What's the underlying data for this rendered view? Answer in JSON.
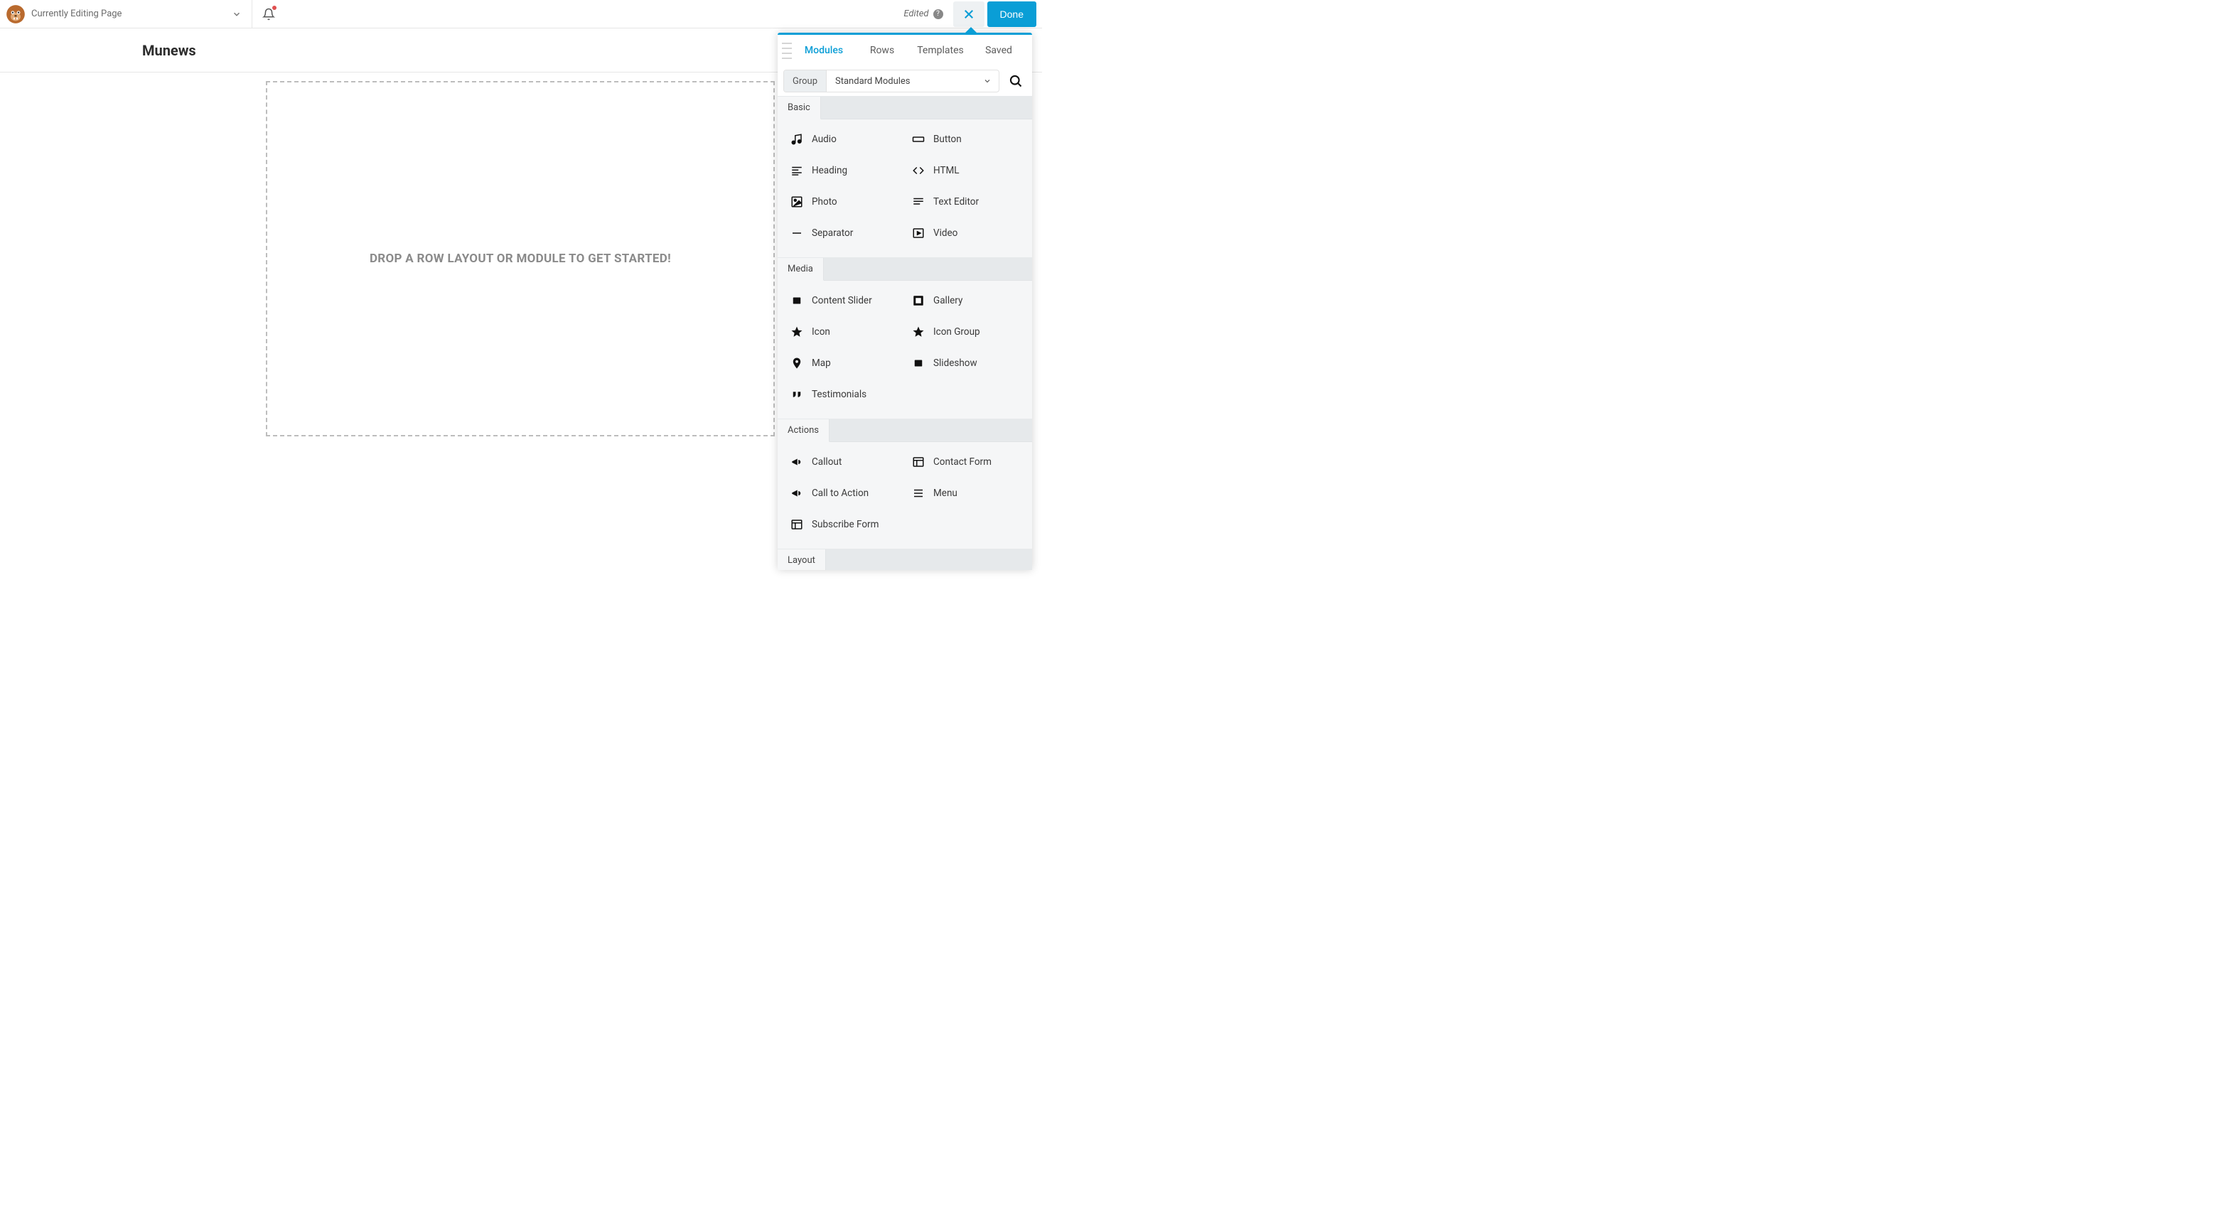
{
  "header": {
    "editing_label": "Currently Editing Page",
    "edited_label": "Edited",
    "done_label": "Done"
  },
  "page": {
    "title": "Munews",
    "dropzone_text": "DROP A ROW LAYOUT OR MODULE TO GET STARTED!"
  },
  "panel": {
    "tabs": {
      "modules": "Modules",
      "rows": "Rows",
      "templates": "Templates",
      "saved": "Saved"
    },
    "active_tab": "modules",
    "group_label": "Group",
    "group_value": "Standard Modules",
    "sections": [
      {
        "title": "Basic",
        "items": [
          {
            "name": "audio",
            "label": "Audio",
            "icon": "music"
          },
          {
            "name": "button",
            "label": "Button",
            "icon": "rect"
          },
          {
            "name": "heading",
            "label": "Heading",
            "icon": "lines-heading"
          },
          {
            "name": "html",
            "label": "HTML",
            "icon": "code"
          },
          {
            "name": "photo",
            "label": "Photo",
            "icon": "image"
          },
          {
            "name": "text-editor",
            "label": "Text Editor",
            "icon": "lines"
          },
          {
            "name": "separator",
            "label": "Separator",
            "icon": "minus"
          },
          {
            "name": "video",
            "label": "Video",
            "icon": "play-frame"
          }
        ]
      },
      {
        "title": "Media",
        "items": [
          {
            "name": "content-slider",
            "label": "Content Slider",
            "icon": "slider"
          },
          {
            "name": "gallery",
            "label": "Gallery",
            "icon": "gallery"
          },
          {
            "name": "icon",
            "label": "Icon",
            "icon": "star"
          },
          {
            "name": "icon-group",
            "label": "Icon Group",
            "icon": "star"
          },
          {
            "name": "map",
            "label": "Map",
            "icon": "pin"
          },
          {
            "name": "slideshow",
            "label": "Slideshow",
            "icon": "slider"
          },
          {
            "name": "testimonials",
            "label": "Testimonials",
            "icon": "quote"
          }
        ]
      },
      {
        "title": "Actions",
        "items": [
          {
            "name": "callout",
            "label": "Callout",
            "icon": "megaphone"
          },
          {
            "name": "contact-form",
            "label": "Contact Form",
            "icon": "form"
          },
          {
            "name": "call-to-action",
            "label": "Call to Action",
            "icon": "megaphone"
          },
          {
            "name": "menu",
            "label": "Menu",
            "icon": "menu"
          },
          {
            "name": "subscribe-form",
            "label": "Subscribe Form",
            "icon": "form"
          }
        ]
      },
      {
        "title": "Layout",
        "items": []
      }
    ]
  }
}
